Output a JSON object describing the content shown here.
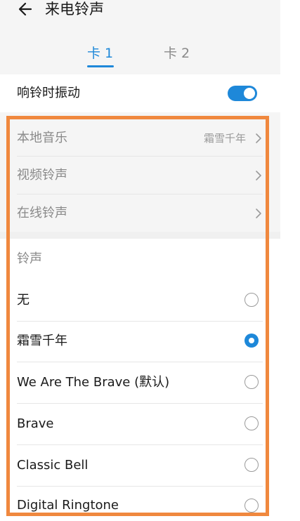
{
  "header": {
    "title": "来电铃声",
    "tabs": [
      {
        "label": "卡 1",
        "active": true
      },
      {
        "label": "卡 2",
        "active": false
      }
    ]
  },
  "vibrate": {
    "label": "响铃时振动",
    "enabled": true
  },
  "nav_items": [
    {
      "label": "本地音乐",
      "value": "霜雪千年"
    },
    {
      "label": "视频铃声",
      "value": ""
    },
    {
      "label": "在线铃声",
      "value": ""
    }
  ],
  "ringtones": {
    "section_label": "铃声",
    "items": [
      {
        "label": "无",
        "selected": false
      },
      {
        "label": "霜雪千年",
        "selected": true
      },
      {
        "label": "We Are The Brave (默认)",
        "selected": false
      },
      {
        "label": "Brave",
        "selected": false
      },
      {
        "label": "Classic Bell",
        "selected": false
      },
      {
        "label": "Digital Ringtone",
        "selected": false
      }
    ]
  },
  "colors": {
    "accent": "#1e88d9",
    "highlight_border": "#f0883e",
    "header_bg": "#f5f5f5"
  },
  "icons": [
    "back-arrow-icon",
    "chevron-right-icon",
    "radio-icon",
    "toggle-switch"
  ]
}
